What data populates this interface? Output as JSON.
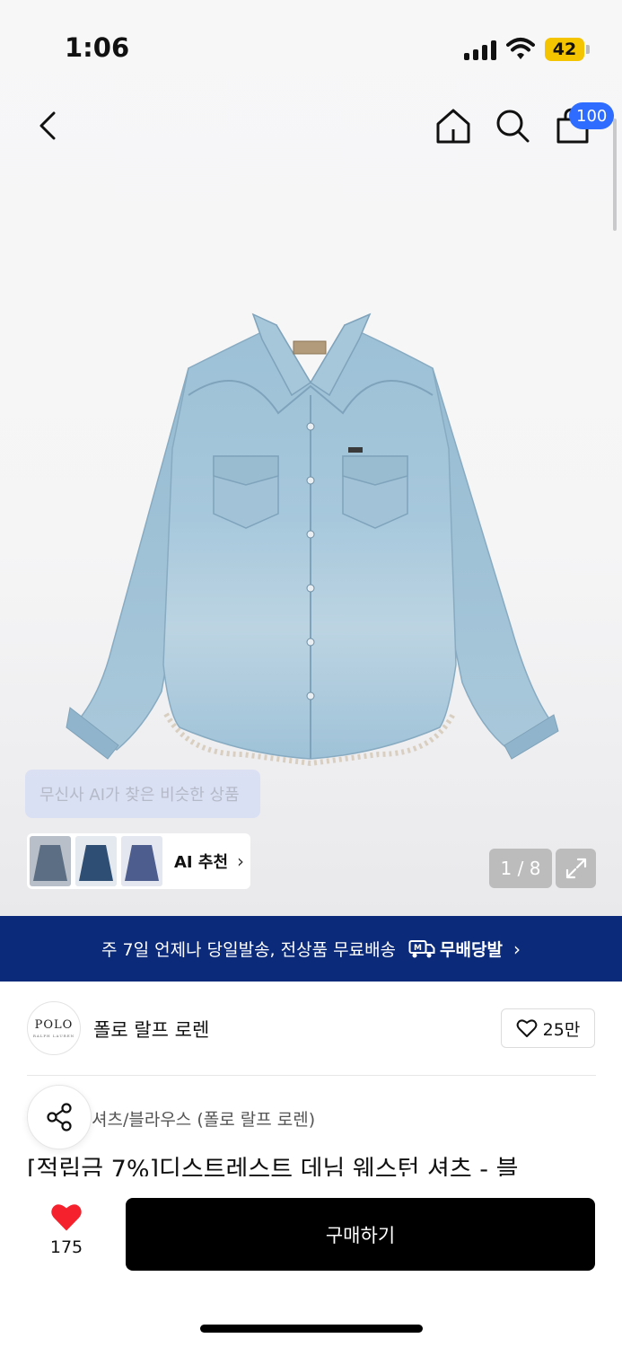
{
  "status_bar": {
    "time": "1:06",
    "battery": "42"
  },
  "header": {
    "cart_count": "100"
  },
  "gallery": {
    "ai_tooltip": "무신사 AI가 찾은 비슷한 상품",
    "ai_recommend_label": "AI 추천",
    "page_indicator": "1 / 8"
  },
  "delivery_banner": {
    "text": "주 7일 언제나 당일발송, 전상품 무료배송",
    "service": "무배당발"
  },
  "brand": {
    "logo_text": "POLO",
    "logo_subtext": "RALPH LAUREN",
    "name": "폴로 랄프 로렌",
    "likes": "25만"
  },
  "product": {
    "category": "셔츠/블라우스 (폴로 랄프 로렌)",
    "title": "[적립금 7%]디스트레스트 데님 웨스턴 셔츠 - 블"
  },
  "bottom_bar": {
    "like_count": "175",
    "buy_label": "구매하기"
  },
  "colors": {
    "accent_blue": "#2d6cff",
    "banner_navy": "#0b2a7a",
    "heart_red": "#f5222d"
  }
}
